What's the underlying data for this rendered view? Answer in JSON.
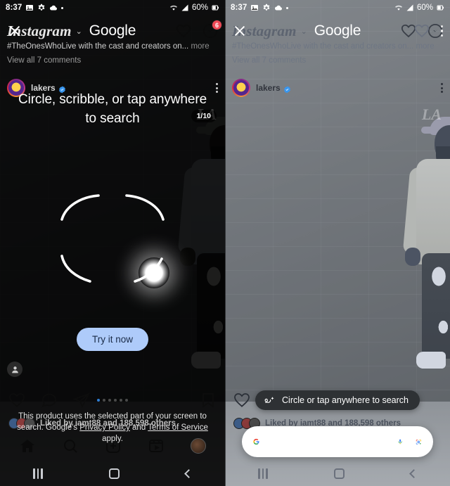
{
  "meta": {
    "accent_blue": "#AECBFA",
    "google_blue": "#4285F4",
    "google_red": "#EA4335",
    "google_yellow": "#FBBC05",
    "google_green": "#34A853",
    "badge_red": "#ED4956",
    "pill_dark": "#2E3134"
  },
  "status_bar": {
    "time": "8:37",
    "battery_percent": "60%",
    "left_icons": [
      "screenshot-icon",
      "gear-icon",
      "cloud-icon",
      "dot-icon"
    ],
    "right_icons": [
      "wifi-icon",
      "signal-icon",
      "battery-icon"
    ]
  },
  "instagram": {
    "logo": "Instagram",
    "chevron": "⌄",
    "header_icons": [
      {
        "name": "heart-icon",
        "badge": ""
      },
      {
        "name": "messenger-icon",
        "badge": "6"
      }
    ],
    "caption_line1": "#TheOnesWhoLive with the cast and creators on...",
    "caption_more": "more",
    "caption_line2": "View all 7 comments",
    "post": {
      "username": "lakers",
      "verified": true,
      "carousel_count": "1/10",
      "watermark": "LA"
    },
    "actions": [
      "like-icon",
      "comment-icon",
      "share-icon",
      "save-icon"
    ],
    "carousel_dots": 6,
    "carousel_active_index": 0,
    "likes_text": "Liked by iamt88 and 188,598 others",
    "bottom_nav": [
      "home-icon",
      "search-icon",
      "create-icon",
      "reels-icon",
      "profile-avatar"
    ]
  },
  "google_overlay": {
    "close_label": "×",
    "wordmark": "Google"
  },
  "left_panel": {
    "onboarding_title": "Circle, scribble, or tap anywhere to search",
    "try_button": "Try it now",
    "legal_prefix": "This product uses the selected part of your screen to search. Google's ",
    "legal_link_1": "Privacy Policy",
    "legal_mid": " and ",
    "legal_link_2": "Terms of Service",
    "legal_suffix": " apply."
  },
  "right_panel": {
    "cts_pill_label": "Circle or tap anywhere to search",
    "cts_pill_icon": "scribble-sparkle-icon",
    "search_placeholder": "",
    "search_value": "",
    "search_icons": [
      "google-g-icon",
      "microphone-icon",
      "google-lens-icon"
    ]
  },
  "system_nav": {
    "items": [
      "recents-button",
      "home-button",
      "back-button"
    ]
  }
}
